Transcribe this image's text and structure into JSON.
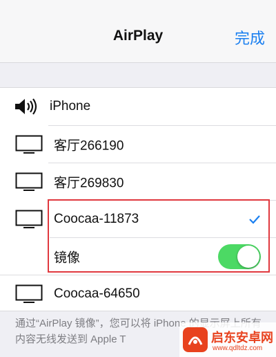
{
  "navbar": {
    "title": "AirPlay",
    "done_label": "完成"
  },
  "devices": [
    {
      "name": "iPhone",
      "icon": "speaker-icon",
      "selected": false
    },
    {
      "name": "客厅266190",
      "icon": "tv-icon",
      "selected": false
    },
    {
      "name": "客厅269830",
      "icon": "tv-icon",
      "selected": false
    },
    {
      "name": "Coocaa-11873",
      "icon": "tv-icon",
      "selected": true
    },
    {
      "name": "Coocaa-64650",
      "icon": "tv-icon",
      "selected": false
    }
  ],
  "mirroring": {
    "label": "镜像",
    "enabled": true
  },
  "footer": {
    "text": "通过“AirPlay 镜像”，您可以将 iPhone 的显示屏上所有内容无线发送到 Apple T"
  },
  "watermark": {
    "title": "启东安卓网",
    "url": "www.qdltdz.com"
  },
  "colors": {
    "accent": "#1a7ff0",
    "toggle_on": "#4cd964",
    "highlight": "#e0383e",
    "watermark": "#e8421e"
  }
}
